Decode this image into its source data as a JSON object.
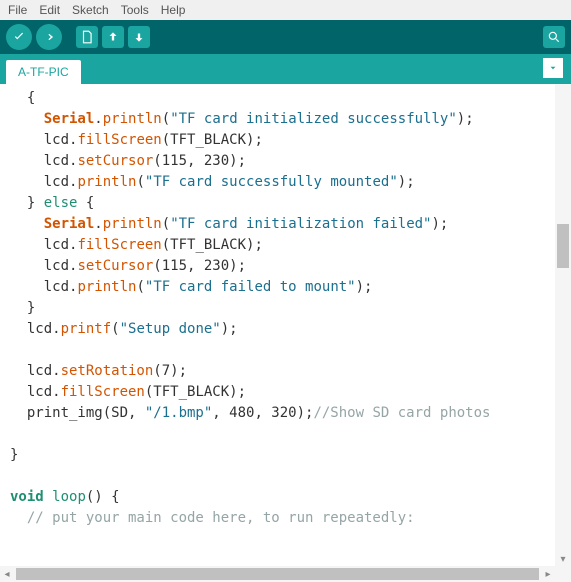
{
  "menu": {
    "items": [
      "File",
      "Edit",
      "Sketch",
      "Tools",
      "Help"
    ]
  },
  "toolbar": {
    "verify": "verify-icon",
    "upload": "upload-icon",
    "new": "new-icon",
    "open": "open-icon",
    "save": "save-icon",
    "monitor": "serial-monitor-icon"
  },
  "tabs": {
    "active": "A-TF-PIC"
  },
  "code": {
    "lines": [
      {
        "indent": 1,
        "tokens": [
          {
            "t": "punct",
            "v": "{"
          }
        ]
      },
      {
        "indent": 2,
        "tokens": [
          {
            "t": "type",
            "v": "Serial"
          },
          {
            "t": "punct",
            "v": "."
          },
          {
            "t": "fn",
            "v": "println"
          },
          {
            "t": "punct",
            "v": "("
          },
          {
            "t": "str",
            "v": "\"TF card initialized successfully\""
          },
          {
            "t": "punct",
            "v": ");"
          }
        ]
      },
      {
        "indent": 2,
        "tokens": [
          {
            "t": "plain",
            "v": "lcd."
          },
          {
            "t": "fn",
            "v": "fillScreen"
          },
          {
            "t": "punct",
            "v": "(TFT_BLACK);"
          }
        ]
      },
      {
        "indent": 2,
        "tokens": [
          {
            "t": "plain",
            "v": "lcd."
          },
          {
            "t": "fn",
            "v": "setCursor"
          },
          {
            "t": "punct",
            "v": "(115, 230);"
          }
        ]
      },
      {
        "indent": 2,
        "tokens": [
          {
            "t": "plain",
            "v": "lcd."
          },
          {
            "t": "fn",
            "v": "println"
          },
          {
            "t": "punct",
            "v": "("
          },
          {
            "t": "str",
            "v": "\"TF card successfully mounted\""
          },
          {
            "t": "punct",
            "v": ");"
          }
        ]
      },
      {
        "indent": 1,
        "tokens": [
          {
            "t": "punct",
            "v": "} "
          },
          {
            "t": "kw",
            "v": "else"
          },
          {
            "t": "punct",
            "v": " {"
          }
        ]
      },
      {
        "indent": 2,
        "tokens": [
          {
            "t": "type",
            "v": "Serial"
          },
          {
            "t": "punct",
            "v": "."
          },
          {
            "t": "fn",
            "v": "println"
          },
          {
            "t": "punct",
            "v": "("
          },
          {
            "t": "str",
            "v": "\"TF card initialization failed\""
          },
          {
            "t": "punct",
            "v": ");"
          }
        ]
      },
      {
        "indent": 2,
        "tokens": [
          {
            "t": "plain",
            "v": "lcd."
          },
          {
            "t": "fn",
            "v": "fillScreen"
          },
          {
            "t": "punct",
            "v": "(TFT_BLACK);"
          }
        ]
      },
      {
        "indent": 2,
        "tokens": [
          {
            "t": "plain",
            "v": "lcd."
          },
          {
            "t": "fn",
            "v": "setCursor"
          },
          {
            "t": "punct",
            "v": "(115, 230);"
          }
        ]
      },
      {
        "indent": 2,
        "tokens": [
          {
            "t": "plain",
            "v": "lcd."
          },
          {
            "t": "fn",
            "v": "println"
          },
          {
            "t": "punct",
            "v": "("
          },
          {
            "t": "str",
            "v": "\"TF card failed to mount\""
          },
          {
            "t": "punct",
            "v": ");"
          }
        ]
      },
      {
        "indent": 1,
        "tokens": [
          {
            "t": "punct",
            "v": "}"
          }
        ]
      },
      {
        "indent": 1,
        "tokens": [
          {
            "t": "plain",
            "v": "lcd."
          },
          {
            "t": "fn",
            "v": "printf"
          },
          {
            "t": "punct",
            "v": "("
          },
          {
            "t": "str",
            "v": "\"Setup done\""
          },
          {
            "t": "punct",
            "v": ");"
          }
        ]
      },
      {
        "indent": 0,
        "tokens": []
      },
      {
        "indent": 1,
        "tokens": [
          {
            "t": "plain",
            "v": "lcd."
          },
          {
            "t": "fn",
            "v": "setRotation"
          },
          {
            "t": "punct",
            "v": "(7);"
          }
        ]
      },
      {
        "indent": 1,
        "tokens": [
          {
            "t": "plain",
            "v": "lcd."
          },
          {
            "t": "fn",
            "v": "fillScreen"
          },
          {
            "t": "punct",
            "v": "(TFT_BLACK);"
          }
        ]
      },
      {
        "indent": 1,
        "tokens": [
          {
            "t": "plain",
            "v": "print_img(SD, "
          },
          {
            "t": "str",
            "v": "\"/1.bmp\""
          },
          {
            "t": "plain",
            "v": ", 480, 320);"
          },
          {
            "t": "com",
            "v": "//Show SD card photos"
          }
        ]
      },
      {
        "indent": 0,
        "tokens": []
      },
      {
        "indent": 0,
        "tokens": [
          {
            "t": "punct",
            "v": "}"
          }
        ]
      },
      {
        "indent": 0,
        "tokens": []
      },
      {
        "indent": 0,
        "tokens": [
          {
            "t": "typekw",
            "v": "void"
          },
          {
            "t": "plain",
            "v": " "
          },
          {
            "t": "kw",
            "v": "loop"
          },
          {
            "t": "punct",
            "v": "() {"
          }
        ]
      },
      {
        "indent": 1,
        "tokens": [
          {
            "t": "com",
            "v": "// put your main code here, to run repeatedly:"
          }
        ]
      },
      {
        "indent": 0,
        "tokens": []
      },
      {
        "indent": 0,
        "tokens": []
      },
      {
        "indent": 0,
        "tokens": [
          {
            "t": "punct",
            "v": "}"
          }
        ]
      }
    ]
  }
}
